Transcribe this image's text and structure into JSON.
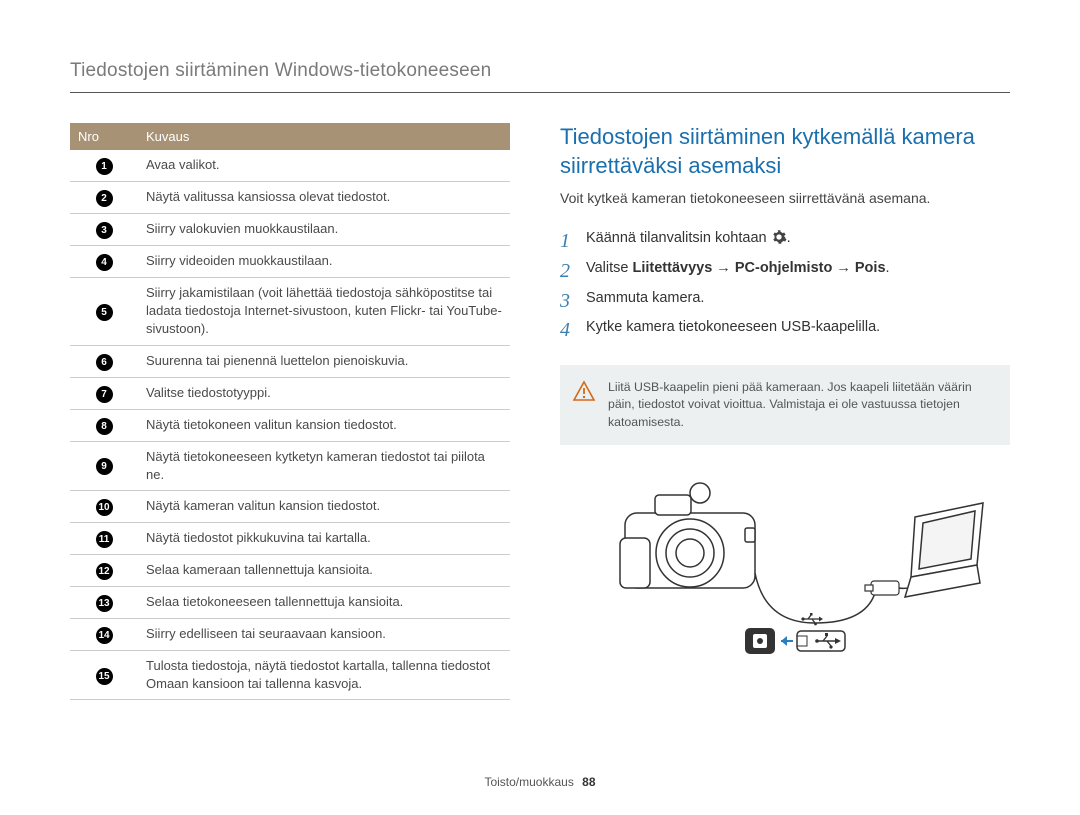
{
  "header": {
    "breadcrumb": "Tiedostojen siirtäminen Windows-tietokoneeseen"
  },
  "table": {
    "header_num": "Nro",
    "header_desc": "Kuvaus",
    "rows": [
      {
        "n": "1",
        "desc": "Avaa valikot."
      },
      {
        "n": "2",
        "desc": "Näytä valitussa kansiossa olevat tiedostot."
      },
      {
        "n": "3",
        "desc": "Siirry valokuvien muokkaustilaan."
      },
      {
        "n": "4",
        "desc": "Siirry videoiden muokkaustilaan."
      },
      {
        "n": "5",
        "desc": "Siirry jakamistilaan (voit lähettää tiedostoja sähköpostitse tai ladata tiedostoja Internet-sivustoon, kuten Flickr- tai YouTube-sivustoon)."
      },
      {
        "n": "6",
        "desc": "Suurenna tai pienennä luettelon pienoiskuvia."
      },
      {
        "n": "7",
        "desc": "Valitse tiedostotyyppi."
      },
      {
        "n": "8",
        "desc": "Näytä tietokoneen valitun kansion tiedostot."
      },
      {
        "n": "9",
        "desc": "Näytä tietokoneeseen kytketyn kameran tiedostot tai piilota ne."
      },
      {
        "n": "10",
        "desc": "Näytä kameran valitun kansion tiedostot."
      },
      {
        "n": "11",
        "desc": "Näytä tiedostot pikkukuvina tai kartalla."
      },
      {
        "n": "12",
        "desc": "Selaa kameraan tallennettuja kansioita."
      },
      {
        "n": "13",
        "desc": "Selaa tietokoneeseen tallennettuja kansioita."
      },
      {
        "n": "14",
        "desc": "Siirry edelliseen tai seuraavaan kansioon."
      },
      {
        "n": "15",
        "desc": "Tulosta tiedostoja, näytä tiedostot kartalla, tallenna tiedostot Omaan kansioon tai tallenna kasvoja."
      }
    ]
  },
  "right": {
    "heading": "Tiedostojen siirtäminen kytkemällä kamera siirrettäväksi asemaksi",
    "intro": "Voit kytkeä kameran tietokoneeseen siirrettävänä asemana.",
    "step1_prefix": "Käännä tilanvalitsin kohtaan ",
    "step1_suffix": ".",
    "step2_prefix": "Valitse ",
    "step2_b1": "Liitettävyys",
    "step2_arrow": " → ",
    "step2_b2": "PC-ohjelmisto",
    "step2_b3": "Pois",
    "step2_suffix": ".",
    "step3": "Sammuta kamera.",
    "step4": "Kytke kamera tietokoneeseen USB-kaapelilla."
  },
  "note": {
    "text": "Liitä USB-kaapelin pieni pää kameraan. Jos kaapeli liitetään väärin päin, tiedostot voivat vioittua. Valmistaja ei ole vastuussa tietojen katoamisesta."
  },
  "footer": {
    "section": "Toisto/muokkaus",
    "page": "88"
  }
}
